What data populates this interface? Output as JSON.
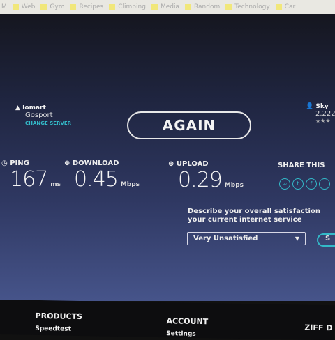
{
  "bookmarks": [
    "M",
    "Web",
    "Gym",
    "Recipes",
    "Climbing",
    "Media",
    "Random",
    "Technology",
    "Car"
  ],
  "server": {
    "host": "Iomart",
    "city": "Gosport",
    "change": "CHANGE SERVER"
  },
  "isp": {
    "name": "Sky",
    "ip": "2.222",
    "stars": "★★★"
  },
  "again": "AGAIN",
  "ping": {
    "label": "PING",
    "value": "167",
    "unit": "ms"
  },
  "download": {
    "label": "DOWNLOAD",
    "value": "0.45",
    "unit": "Mbps"
  },
  "upload": {
    "label": "UPLOAD",
    "value": "0.29",
    "unit": "Mbps"
  },
  "share": {
    "label": "SHARE THIS"
  },
  "survey": {
    "line1": "Describe your overall satisfaction",
    "line2": "your current internet service",
    "selected": "Very Unsatisfied",
    "submit": "S"
  },
  "footer": {
    "products": "PRODUCTS",
    "speedtest": "Speedtest",
    "account": "ACCOUNT",
    "settings": "Settings",
    "ziff": "ZIFF D"
  },
  "colors": {
    "accent": "#33b9c8"
  }
}
